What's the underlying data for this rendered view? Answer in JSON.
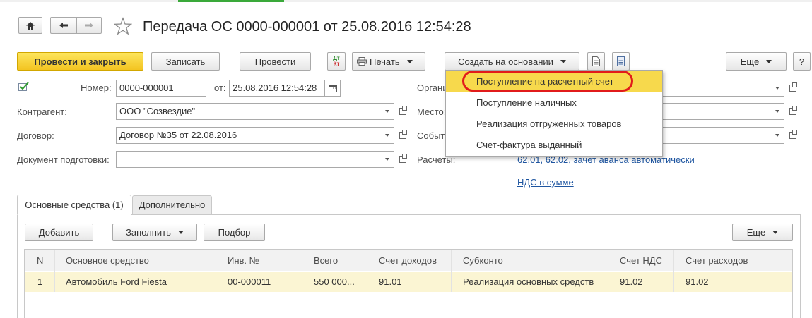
{
  "window": {
    "title": "Передача ОС 0000-000001 от 25.08.2016 12:54:28"
  },
  "toolbar": {
    "post_close_label": "Провести и закрыть",
    "save_label": "Записать",
    "post_label": "Провести",
    "print_label": "Печать",
    "create_based_label": "Создать на основании",
    "more_label": "Еще",
    "help_label": "?"
  },
  "dropdown_menu": {
    "items": [
      "Поступление на расчетный счет",
      "Поступление наличных",
      "Реализация отгруженных товаров",
      "Счет-фактура выданный"
    ]
  },
  "form": {
    "number_label": "Номер:",
    "number_value": "0000-000001",
    "date_label": "от:",
    "date_value": "25.08.2016 12:54:28",
    "org_label": "Организация:",
    "counterparty_label": "Контрагент:",
    "counterparty_value": "ООО \"Созвездие\"",
    "place_label": "Место:",
    "contract_label": "Договор:",
    "contract_value": "Договор №35 от 22.08.2016",
    "event_label": "Событие:",
    "prep_doc_label": "Документ подготовки:",
    "prep_doc_value": "",
    "settlements_label": "Расчеты:",
    "settlements_link": "62.01, 62.02, зачет аванса автоматически",
    "vat_link": "НДС в сумме"
  },
  "tabs": [
    {
      "label": "Основные средства (1)"
    },
    {
      "label": "Дополнительно"
    }
  ],
  "table_toolbar": {
    "add_label": "Добавить",
    "fill_label": "Заполнить",
    "select_label": "Подбор",
    "more_label": "Еще"
  },
  "table": {
    "headers": [
      "N",
      "Основное средство",
      "Инв. №",
      "Всего",
      "Счет доходов",
      "Субконто",
      "Счет НДС",
      "Счет расходов"
    ],
    "rows": [
      [
        "1",
        "Автомобиль Ford Fiesta",
        "00-000011",
        "550 000...",
        "91.01",
        "Реализация основных средств",
        "91.02",
        "91.02"
      ]
    ]
  },
  "colors": {
    "accent_yellow": "#f5c926",
    "row_highlight": "#fbf5d3",
    "menu_highlight": "#f7d94c",
    "annotation_red": "#e11b1b",
    "link_blue": "#1e55a0"
  }
}
